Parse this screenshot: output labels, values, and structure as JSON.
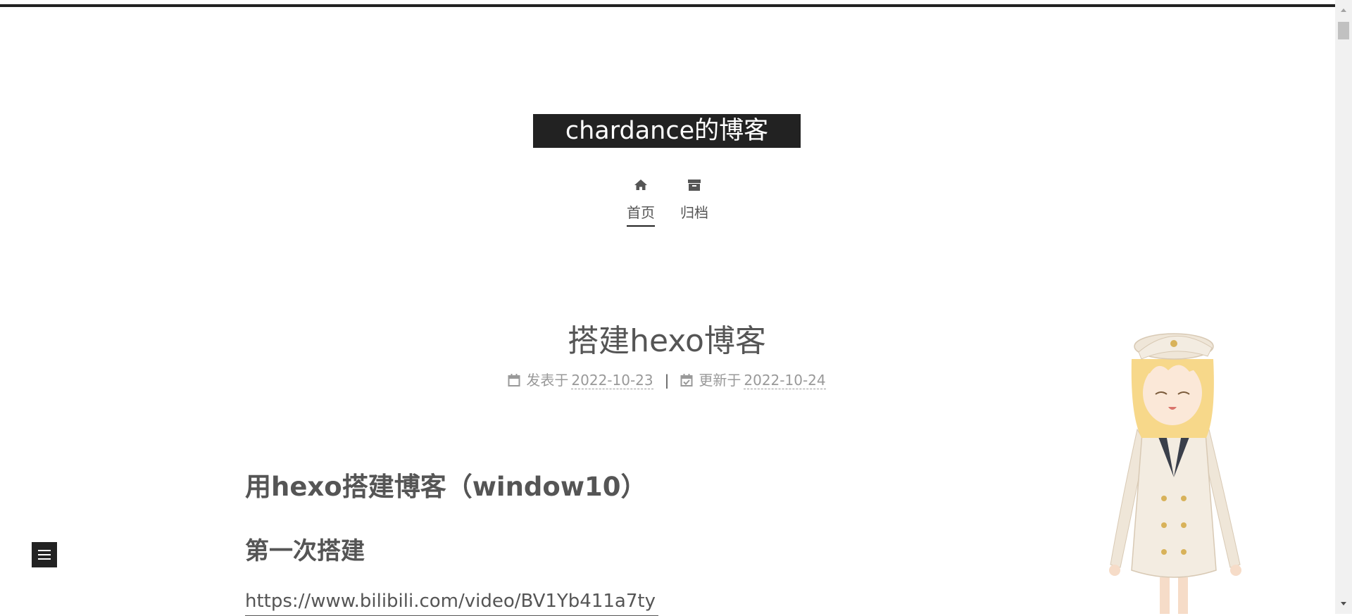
{
  "site": {
    "title": "chardance的博客"
  },
  "menu": {
    "items": [
      {
        "label": "首页",
        "icon": "home-icon",
        "active": true
      },
      {
        "label": "归档",
        "icon": "archive-icon",
        "active": false
      }
    ]
  },
  "post": {
    "title": "搭建hexo博客",
    "meta": {
      "posted_label": "发表于",
      "posted_date": "2022-10-23",
      "separator": "|",
      "updated_label": "更新于",
      "updated_date": "2022-10-24"
    },
    "heading": "用hexo搭建博客（window10）",
    "subheading": "第一次搭建",
    "link": "https://www.bilibili.com/video/BV1Yb411a7ty"
  },
  "colors": {
    "brand_bg": "#222222",
    "text": "#555555",
    "meta": "#999999"
  },
  "widgets": {
    "sidebar_toggle_icon": "menu-icon",
    "mascot": "anime-girl-mascot"
  }
}
